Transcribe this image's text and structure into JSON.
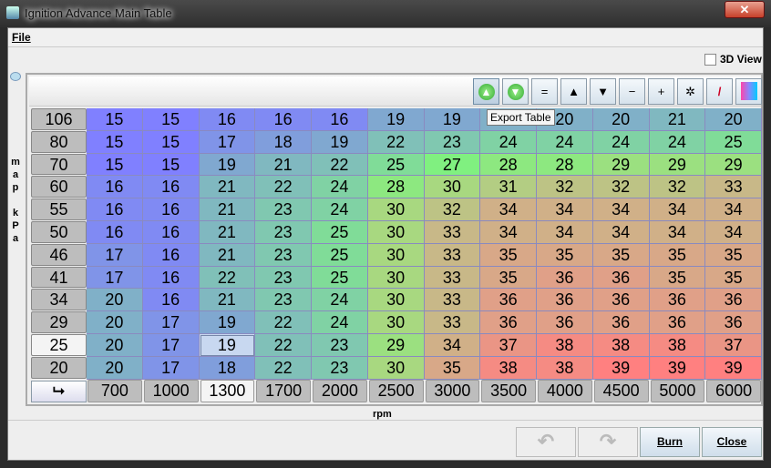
{
  "window": {
    "title": "Ignition Advance Main Table"
  },
  "menu": {
    "file": "File"
  },
  "view3d": {
    "label": "3D View",
    "checked": false
  },
  "toolbar": {
    "buttons": [
      {
        "name": "import-table-button",
        "glyph": "▲",
        "icon": "green-up-arrow-icon"
      },
      {
        "name": "export-table-button",
        "glyph": "▼",
        "icon": "green-down-arrow-icon"
      },
      {
        "name": "set-equal-button",
        "glyph": "="
      },
      {
        "name": "increment-button",
        "glyph": "▲"
      },
      {
        "name": "decrement-button",
        "glyph": "▼"
      },
      {
        "name": "subtract-button",
        "glyph": "−"
      },
      {
        "name": "add-button",
        "glyph": "+"
      },
      {
        "name": "multiply-button",
        "glyph": "✲"
      },
      {
        "name": "interpolate-button",
        "glyph": "/",
        "icon": "pencil-icon"
      },
      {
        "name": "color-scale-button",
        "glyph": "",
        "icon": "gradient-icon"
      }
    ],
    "tooltip": "Export Table"
  },
  "axes": {
    "y_label": "map kPa",
    "x_label": "rpm",
    "corner": "⮡"
  },
  "table": {
    "rows": [
      "106",
      "80",
      "70",
      "60",
      "55",
      "50",
      "46",
      "41",
      "34",
      "29",
      "25",
      "20"
    ],
    "cols": [
      "700",
      "1000",
      "1300",
      "1700",
      "2000",
      "2500",
      "3000",
      "3500",
      "4000",
      "4500",
      "5000",
      "6000"
    ],
    "values": [
      [
        15,
        15,
        16,
        16,
        16,
        19,
        19,
        null,
        20,
        20,
        21,
        20
      ],
      [
        15,
        15,
        17,
        18,
        19,
        22,
        23,
        24,
        24,
        24,
        24,
        25
      ],
      [
        15,
        15,
        19,
        21,
        22,
        25,
        27,
        28,
        28,
        29,
        29,
        29
      ],
      [
        16,
        16,
        21,
        22,
        24,
        28,
        30,
        31,
        32,
        32,
        32,
        33
      ],
      [
        16,
        16,
        21,
        23,
        24,
        30,
        32,
        34,
        34,
        34,
        34,
        34
      ],
      [
        16,
        16,
        21,
        23,
        25,
        30,
        33,
        34,
        34,
        34,
        34,
        34
      ],
      [
        17,
        16,
        21,
        23,
        25,
        30,
        33,
        35,
        35,
        35,
        35,
        35
      ],
      [
        17,
        16,
        22,
        23,
        25,
        30,
        33,
        35,
        36,
        36,
        35,
        35
      ],
      [
        20,
        16,
        21,
        23,
        24,
        30,
        33,
        36,
        36,
        36,
        36,
        36
      ],
      [
        20,
        17,
        19,
        22,
        24,
        30,
        33,
        36,
        36,
        36,
        36,
        36
      ],
      [
        20,
        17,
        19,
        22,
        23,
        29,
        34,
        37,
        38,
        38,
        38,
        37
      ],
      [
        20,
        17,
        18,
        22,
        23,
        30,
        35,
        38,
        38,
        39,
        39,
        39
      ]
    ],
    "selected": {
      "row": "25",
      "col": "1300"
    }
  },
  "buttons": {
    "undo": "↶",
    "redo": "↷",
    "burn": "Burn",
    "close": "Close"
  }
}
